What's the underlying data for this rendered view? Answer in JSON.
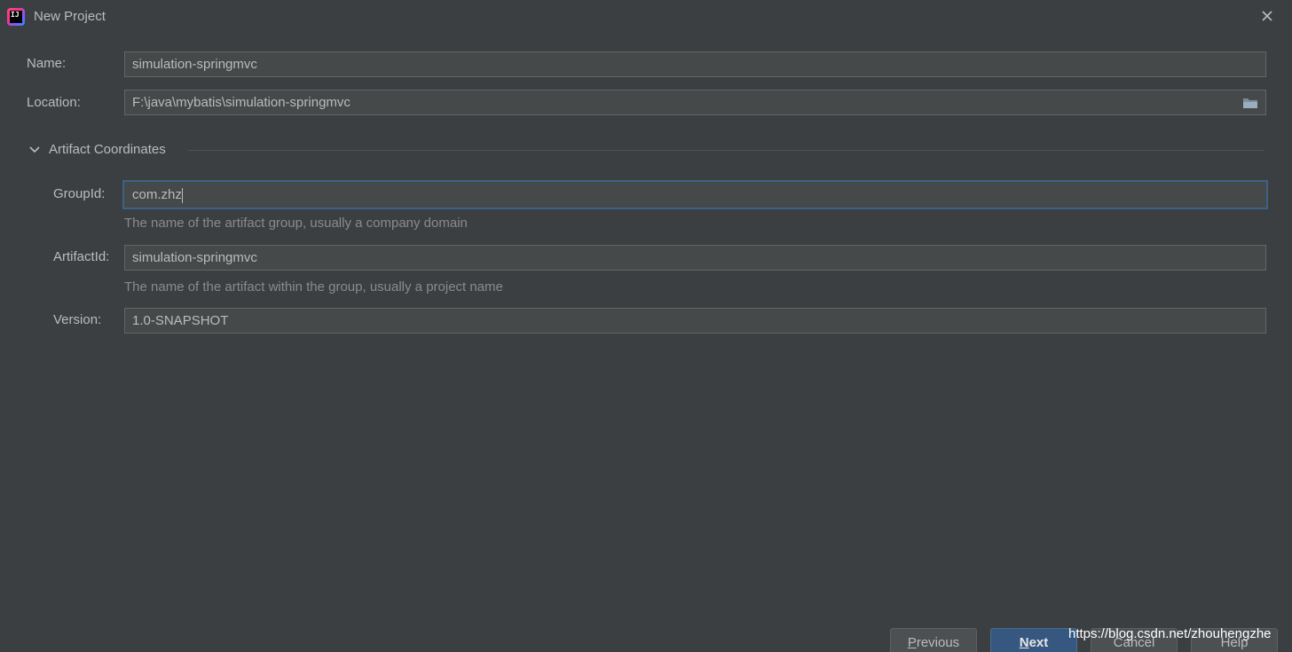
{
  "window": {
    "title": "New Project",
    "close_symbol": "×"
  },
  "form": {
    "name_label": "Name:",
    "name_value": "simulation-springmvc",
    "location_label": "Location:",
    "location_value": "F:\\java\\mybatis\\simulation-springmvc",
    "section_title": "Artifact Coordinates",
    "groupid_label": "GroupId:",
    "groupid_value": "com.zhz",
    "groupid_hint": "The name of the artifact group, usually a company domain",
    "artifactid_label": "ArtifactId:",
    "artifactid_value": "simulation-springmvc",
    "artifactid_hint": "The name of the artifact within the group, usually a project name",
    "version_label": "Version:",
    "version_value": "1.0-SNAPSHOT"
  },
  "buttons": {
    "previous_mnemonic": "P",
    "previous_rest": "revious",
    "next_mnemonic": "N",
    "next_rest": "ext",
    "cancel_label": "Cancel",
    "help_label": "Help"
  },
  "watermark": "https://blog.csdn.net/zhouhengzhe",
  "colors": {
    "background": "#3c3f41",
    "field_background": "#45494a",
    "focus_border": "#3d6185",
    "primary_button": "#365880"
  },
  "icons": {
    "app": "intellij-idea-icon",
    "close": "close-icon",
    "folder": "folder-icon",
    "chevron": "chevron-down-icon"
  }
}
